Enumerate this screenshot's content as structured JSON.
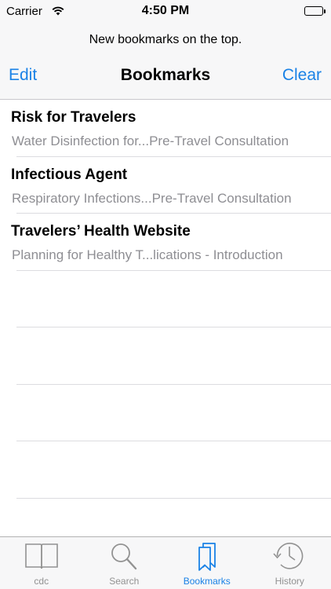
{
  "status_bar": {
    "carrier": "Carrier",
    "time": "4:50 PM"
  },
  "header": {
    "prompt": "New bookmarks on the top.",
    "edit_label": "Edit",
    "title": "Bookmarks",
    "clear_label": "Clear"
  },
  "bookmarks": [
    {
      "title": "Risk for Travelers",
      "subtitle": "Water Disinfection for...Pre-Travel Consultation"
    },
    {
      "title": "Infectious Agent",
      "subtitle": "Respiratory Infections...Pre-Travel Consultation"
    },
    {
      "title": "Travelers’ Health Website",
      "subtitle": "Planning for Healthy T...lications - Introduction"
    }
  ],
  "tab_bar": {
    "tabs": [
      {
        "label": "cdc",
        "icon": "book-icon"
      },
      {
        "label": "Search",
        "icon": "search-icon"
      },
      {
        "label": "Bookmarks",
        "icon": "bookmarks-icon"
      },
      {
        "label": "History",
        "icon": "history-icon"
      }
    ],
    "active_index": 2
  },
  "colors": {
    "accent": "#1a82e6",
    "inactive": "#929292",
    "subtitle": "#8e8e93",
    "bar_background": "#f7f7f8"
  }
}
